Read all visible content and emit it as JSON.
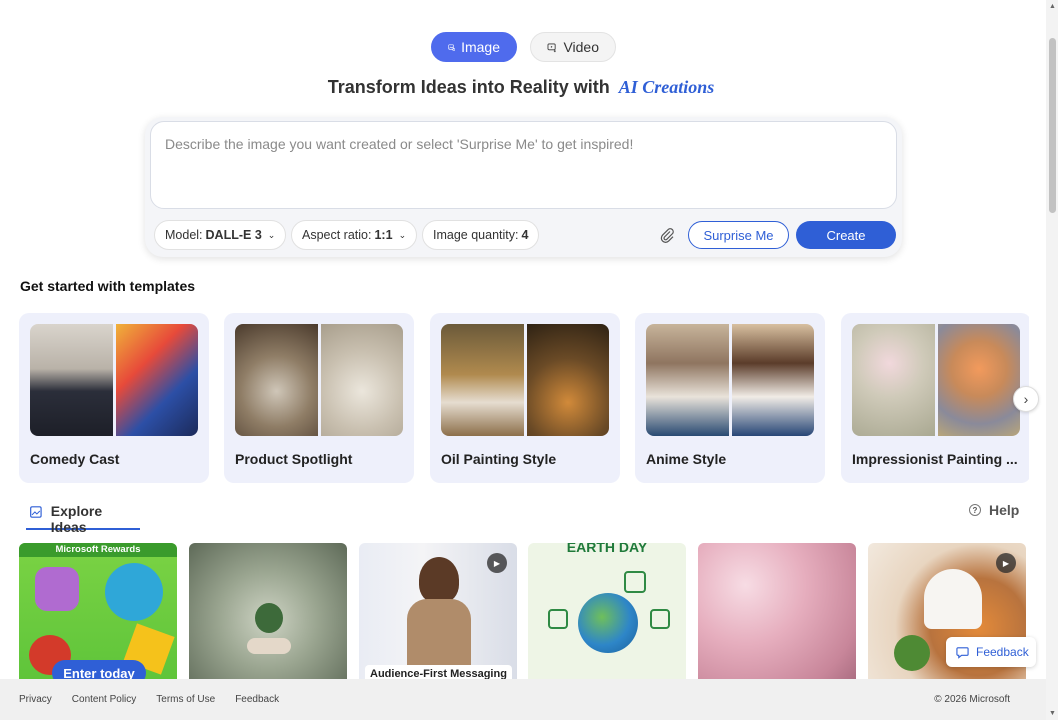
{
  "mode_toggle": {
    "image_label": "Image",
    "video_label": "Video",
    "active": "Image"
  },
  "headline": {
    "text": "Transform Ideas into Reality with",
    "accent": "AI Creations"
  },
  "prompt": {
    "placeholder": "Describe the image you want created or select 'Surprise Me' to get inspired!",
    "value": ""
  },
  "options": {
    "model_label": "Model:",
    "model_value": "DALL-E 3",
    "aspect_label": "Aspect ratio:",
    "aspect_value": "1:1",
    "quantity_label": "Image quantity:",
    "quantity_value": "4"
  },
  "actions": {
    "surprise_label": "Surprise Me",
    "create_label": "Create"
  },
  "templates": {
    "title": "Get started with templates",
    "items": [
      {
        "label": "Comedy Cast"
      },
      {
        "label": "Product Spotlight"
      },
      {
        "label": "Oil Painting Style"
      },
      {
        "label": "Anime Style"
      },
      {
        "label": "Impressionist Painting ..."
      }
    ]
  },
  "explore": {
    "tab_label": "Explore Ideas",
    "help_label": "Help",
    "ideas": [
      {
        "banner": "Microsoft Rewards",
        "button": "Enter today"
      },
      {},
      {
        "caption": "Audience-First Messaging"
      },
      {
        "caption": "EARTH DAY"
      },
      {},
      {}
    ]
  },
  "feedback_float": {
    "label": "Feedback"
  },
  "footer": {
    "links": [
      "Privacy",
      "Content Policy",
      "Terms of Use",
      "Feedback"
    ],
    "copyright": "© 2026 Microsoft"
  },
  "colors": {
    "accent": "#2f5fd6",
    "toggle_active": "#4f6bed",
    "template_card_bg": "#eef0fb"
  }
}
